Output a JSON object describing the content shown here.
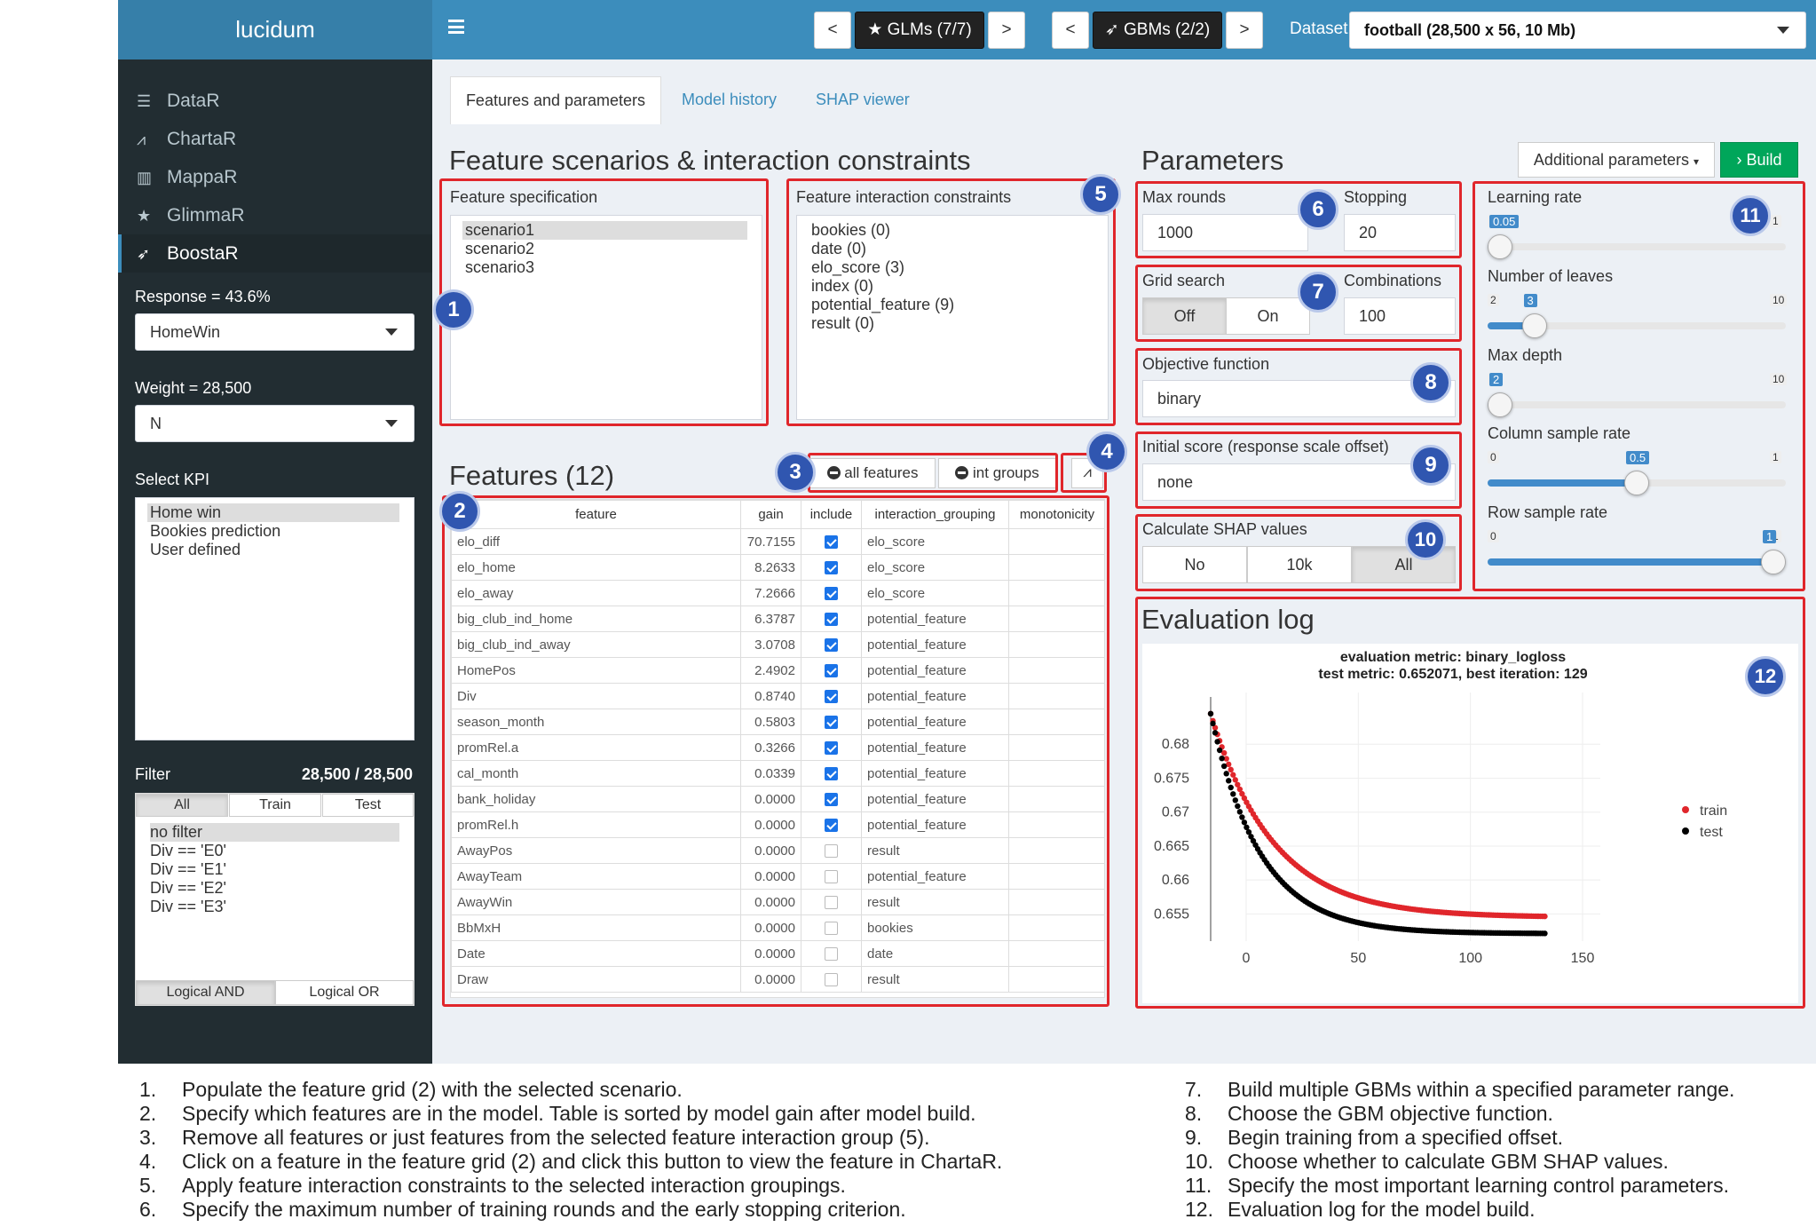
{
  "app": {
    "title": "lucidum"
  },
  "topbar": {
    "prev": "<",
    "next": "<",
    "glms": "GLMs (7/7)",
    "glms_next": ">",
    "gbm_prev": "<",
    "gbms": "GBMs (2/2)",
    "gbm_next": ">",
    "dataset_label": "Dataset",
    "dataset_value": "football (28,500 x 56, 10 Mb)"
  },
  "sidebar": {
    "items": [
      {
        "label": "DataR",
        "icon": "list-icon"
      },
      {
        "label": "ChartaR",
        "icon": "area-chart-icon"
      },
      {
        "label": "MappaR",
        "icon": "map-icon"
      },
      {
        "label": "GlimmaR",
        "icon": "star-icon"
      },
      {
        "label": "BoostaR",
        "icon": "rocket-icon"
      }
    ],
    "response_label": "Response = 43.6%",
    "response_value": "HomeWin",
    "weight_label": "Weight = 28,500",
    "weight_value": "N",
    "kpi_label": "Select KPI",
    "kpi_options": [
      "Home win",
      "Bookies prediction",
      "User defined"
    ],
    "filter_label": "Filter",
    "filter_count": "28,500 / 28,500",
    "filter_tabs": [
      "All",
      "Train",
      "Test"
    ],
    "filter_options": [
      "no filter",
      "Div == 'E0'",
      "Div == 'E1'",
      "Div == 'E2'",
      "Div == 'E3'"
    ],
    "logic_and": "Logical AND",
    "logic_or": "Logical OR"
  },
  "tabs": [
    "Features and parameters",
    "Model history",
    "SHAP viewer"
  ],
  "scenarios": {
    "title": "Feature scenarios & interaction constraints",
    "spec_label": "Feature specification",
    "spec_options": [
      "scenario1",
      "scenario2",
      "scenario3"
    ],
    "ic_label": "Feature interaction constraints",
    "ic_options": [
      "bookies (0)",
      "date (0)",
      "elo_score (3)",
      "index (0)",
      "potential_feature (9)",
      "result (0)"
    ]
  },
  "features": {
    "title": "Features (12)",
    "all_btn": "all features",
    "int_btn": "int groups",
    "columns": [
      "feature",
      "gain",
      "include",
      "interaction_grouping",
      "monotonicity"
    ],
    "rows": [
      {
        "feature": "elo_diff",
        "gain": "70.7155",
        "include": true,
        "group": "elo_score"
      },
      {
        "feature": "elo_home",
        "gain": "8.2633",
        "include": true,
        "group": "elo_score"
      },
      {
        "feature": "elo_away",
        "gain": "7.2666",
        "include": true,
        "group": "elo_score"
      },
      {
        "feature": "big_club_ind_home",
        "gain": "6.3787",
        "include": true,
        "group": "potential_feature"
      },
      {
        "feature": "big_club_ind_away",
        "gain": "3.0708",
        "include": true,
        "group": "potential_feature"
      },
      {
        "feature": "HomePos",
        "gain": "2.4902",
        "include": true,
        "group": "potential_feature"
      },
      {
        "feature": "Div",
        "gain": "0.8740",
        "include": true,
        "group": "potential_feature"
      },
      {
        "feature": "season_month",
        "gain": "0.5803",
        "include": true,
        "group": "potential_feature"
      },
      {
        "feature": "promRel.a",
        "gain": "0.3266",
        "include": true,
        "group": "potential_feature"
      },
      {
        "feature": "cal_month",
        "gain": "0.0339",
        "include": true,
        "group": "potential_feature"
      },
      {
        "feature": "bank_holiday",
        "gain": "0.0000",
        "include": true,
        "group": "potential_feature"
      },
      {
        "feature": "promRel.h",
        "gain": "0.0000",
        "include": true,
        "group": "potential_feature"
      },
      {
        "feature": "AwayPos",
        "gain": "0.0000",
        "include": false,
        "group": "result"
      },
      {
        "feature": "AwayTeam",
        "gain": "0.0000",
        "include": false,
        "group": "potential_feature"
      },
      {
        "feature": "AwayWin",
        "gain": "0.0000",
        "include": false,
        "group": "result"
      },
      {
        "feature": "BbMxH",
        "gain": "0.0000",
        "include": false,
        "group": "bookies"
      },
      {
        "feature": "Date",
        "gain": "0.0000",
        "include": false,
        "group": "date"
      },
      {
        "feature": "Draw",
        "gain": "0.0000",
        "include": false,
        "group": "result"
      }
    ]
  },
  "params": {
    "title": "Parameters",
    "additional": "Additional parameters",
    "build": "Build",
    "max_rounds_label": "Max rounds",
    "max_rounds": "1000",
    "stopping_label": "Stopping",
    "stopping": "20",
    "grid_label": "Grid search",
    "grid_off": "Off",
    "grid_on": "On",
    "comb_label": "Combinations",
    "comb": "100",
    "obj_label": "Objective function",
    "obj": "binary",
    "init_label": "Initial score (response scale offset)",
    "init": "none",
    "shap_label": "Calculate SHAP values",
    "shap_no": "No",
    "shap_10k": "10k",
    "shap_all": "All",
    "sliders": [
      {
        "label": "Learning rate",
        "min": "0.05",
        "max": "1",
        "value": "0.05",
        "frac": 0.0
      },
      {
        "label": "Number of leaves",
        "min": "2",
        "max": "10",
        "value": "3",
        "frac": 0.125
      },
      {
        "label": "Max depth",
        "min": "2",
        "max": "10",
        "value": "2",
        "frac": 0.0
      },
      {
        "label": "Column sample rate",
        "min": "0",
        "max": "1",
        "value": "0.5",
        "frac": 0.5
      },
      {
        "label": "Row sample rate",
        "min": "0",
        "max": "1",
        "value": "1",
        "frac": 1.0
      }
    ]
  },
  "eval": {
    "title": "Evaluation log",
    "subtitle1": "evaluation metric: binary_logloss",
    "subtitle2": "test metric: 0.652071, best iteration: 129",
    "legend_train": "train",
    "legend_test": "test"
  },
  "chart_data": {
    "type": "scatter",
    "title": "evaluation metric: binary_logloss",
    "subtitle": "test metric: 0.652071, best iteration: 129",
    "xlabel": "",
    "ylabel": "",
    "xlim": [
      0,
      150
    ],
    "ylim": [
      0.651,
      0.685
    ],
    "xticks": [
      0,
      50,
      100,
      150
    ],
    "yticks": [
      0.655,
      0.66,
      0.665,
      0.67,
      0.675,
      0.68
    ],
    "series": [
      {
        "name": "train",
        "color": "#e0262b",
        "start": 0.6845,
        "end": 0.6545,
        "tau": 28
      },
      {
        "name": "test",
        "color": "#000000",
        "start": 0.6845,
        "end": 0.6521,
        "tau": 22
      }
    ],
    "n_points": 150,
    "legend": "right"
  },
  "badges": [
    "1",
    "2",
    "3",
    "4",
    "5",
    "6",
    "7",
    "8",
    "9",
    "10",
    "11",
    "12"
  ],
  "footnotes_left": [
    {
      "n": "1.",
      "t": "Populate the feature grid (2) with the selected scenario."
    },
    {
      "n": "2.",
      "t": "Specify which features are in the model. Table is sorted by model gain after model build."
    },
    {
      "n": "3.",
      "t": "Remove all features or just features from the selected feature interaction group (5)."
    },
    {
      "n": "4.",
      "t": "Click on a feature in the feature grid (2) and click this button to view the feature in ChartaR."
    },
    {
      "n": "5.",
      "t": "Apply feature interaction constraints to the selected interaction groupings."
    },
    {
      "n": "6.",
      "t": "Specify the maximum number of training rounds and the early stopping criterion."
    }
  ],
  "footnotes_right": [
    {
      "n": "7.",
      "t": "Build multiple GBMs within a specified parameter range."
    },
    {
      "n": "8.",
      "t": "Choose the GBM objective function."
    },
    {
      "n": "9.",
      "t": "Begin training from a specified offset."
    },
    {
      "n": "10.",
      "t": "Choose whether to calculate GBM SHAP values."
    },
    {
      "n": "11.",
      "t": "Specify the most important learning control parameters."
    },
    {
      "n": "12.",
      "t": "Evaluation log for the model build."
    }
  ]
}
